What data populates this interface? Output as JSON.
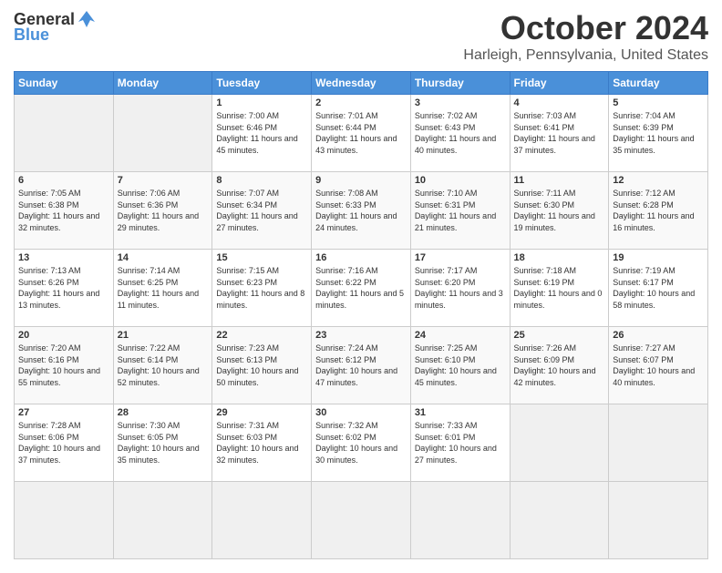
{
  "logo": {
    "general": "General",
    "blue": "Blue"
  },
  "title": "October 2024",
  "location": "Harleigh, Pennsylvania, United States",
  "weekdays": [
    "Sunday",
    "Monday",
    "Tuesday",
    "Wednesday",
    "Thursday",
    "Friday",
    "Saturday"
  ],
  "days": [
    {
      "num": "",
      "sunrise": "",
      "sunset": "",
      "daylight": ""
    },
    {
      "num": "",
      "sunrise": "",
      "sunset": "",
      "daylight": ""
    },
    {
      "num": "1",
      "sunrise": "Sunrise: 7:00 AM",
      "sunset": "Sunset: 6:46 PM",
      "daylight": "Daylight: 11 hours and 45 minutes."
    },
    {
      "num": "2",
      "sunrise": "Sunrise: 7:01 AM",
      "sunset": "Sunset: 6:44 PM",
      "daylight": "Daylight: 11 hours and 43 minutes."
    },
    {
      "num": "3",
      "sunrise": "Sunrise: 7:02 AM",
      "sunset": "Sunset: 6:43 PM",
      "daylight": "Daylight: 11 hours and 40 minutes."
    },
    {
      "num": "4",
      "sunrise": "Sunrise: 7:03 AM",
      "sunset": "Sunset: 6:41 PM",
      "daylight": "Daylight: 11 hours and 37 minutes."
    },
    {
      "num": "5",
      "sunrise": "Sunrise: 7:04 AM",
      "sunset": "Sunset: 6:39 PM",
      "daylight": "Daylight: 11 hours and 35 minutes."
    },
    {
      "num": "6",
      "sunrise": "Sunrise: 7:05 AM",
      "sunset": "Sunset: 6:38 PM",
      "daylight": "Daylight: 11 hours and 32 minutes."
    },
    {
      "num": "7",
      "sunrise": "Sunrise: 7:06 AM",
      "sunset": "Sunset: 6:36 PM",
      "daylight": "Daylight: 11 hours and 29 minutes."
    },
    {
      "num": "8",
      "sunrise": "Sunrise: 7:07 AM",
      "sunset": "Sunset: 6:34 PM",
      "daylight": "Daylight: 11 hours and 27 minutes."
    },
    {
      "num": "9",
      "sunrise": "Sunrise: 7:08 AM",
      "sunset": "Sunset: 6:33 PM",
      "daylight": "Daylight: 11 hours and 24 minutes."
    },
    {
      "num": "10",
      "sunrise": "Sunrise: 7:10 AM",
      "sunset": "Sunset: 6:31 PM",
      "daylight": "Daylight: 11 hours and 21 minutes."
    },
    {
      "num": "11",
      "sunrise": "Sunrise: 7:11 AM",
      "sunset": "Sunset: 6:30 PM",
      "daylight": "Daylight: 11 hours and 19 minutes."
    },
    {
      "num": "12",
      "sunrise": "Sunrise: 7:12 AM",
      "sunset": "Sunset: 6:28 PM",
      "daylight": "Daylight: 11 hours and 16 minutes."
    },
    {
      "num": "13",
      "sunrise": "Sunrise: 7:13 AM",
      "sunset": "Sunset: 6:26 PM",
      "daylight": "Daylight: 11 hours and 13 minutes."
    },
    {
      "num": "14",
      "sunrise": "Sunrise: 7:14 AM",
      "sunset": "Sunset: 6:25 PM",
      "daylight": "Daylight: 11 hours and 11 minutes."
    },
    {
      "num": "15",
      "sunrise": "Sunrise: 7:15 AM",
      "sunset": "Sunset: 6:23 PM",
      "daylight": "Daylight: 11 hours and 8 minutes."
    },
    {
      "num": "16",
      "sunrise": "Sunrise: 7:16 AM",
      "sunset": "Sunset: 6:22 PM",
      "daylight": "Daylight: 11 hours and 5 minutes."
    },
    {
      "num": "17",
      "sunrise": "Sunrise: 7:17 AM",
      "sunset": "Sunset: 6:20 PM",
      "daylight": "Daylight: 11 hours and 3 minutes."
    },
    {
      "num": "18",
      "sunrise": "Sunrise: 7:18 AM",
      "sunset": "Sunset: 6:19 PM",
      "daylight": "Daylight: 11 hours and 0 minutes."
    },
    {
      "num": "19",
      "sunrise": "Sunrise: 7:19 AM",
      "sunset": "Sunset: 6:17 PM",
      "daylight": "Daylight: 10 hours and 58 minutes."
    },
    {
      "num": "20",
      "sunrise": "Sunrise: 7:20 AM",
      "sunset": "Sunset: 6:16 PM",
      "daylight": "Daylight: 10 hours and 55 minutes."
    },
    {
      "num": "21",
      "sunrise": "Sunrise: 7:22 AM",
      "sunset": "Sunset: 6:14 PM",
      "daylight": "Daylight: 10 hours and 52 minutes."
    },
    {
      "num": "22",
      "sunrise": "Sunrise: 7:23 AM",
      "sunset": "Sunset: 6:13 PM",
      "daylight": "Daylight: 10 hours and 50 minutes."
    },
    {
      "num": "23",
      "sunrise": "Sunrise: 7:24 AM",
      "sunset": "Sunset: 6:12 PM",
      "daylight": "Daylight: 10 hours and 47 minutes."
    },
    {
      "num": "24",
      "sunrise": "Sunrise: 7:25 AM",
      "sunset": "Sunset: 6:10 PM",
      "daylight": "Daylight: 10 hours and 45 minutes."
    },
    {
      "num": "25",
      "sunrise": "Sunrise: 7:26 AM",
      "sunset": "Sunset: 6:09 PM",
      "daylight": "Daylight: 10 hours and 42 minutes."
    },
    {
      "num": "26",
      "sunrise": "Sunrise: 7:27 AM",
      "sunset": "Sunset: 6:07 PM",
      "daylight": "Daylight: 10 hours and 40 minutes."
    },
    {
      "num": "27",
      "sunrise": "Sunrise: 7:28 AM",
      "sunset": "Sunset: 6:06 PM",
      "daylight": "Daylight: 10 hours and 37 minutes."
    },
    {
      "num": "28",
      "sunrise": "Sunrise: 7:30 AM",
      "sunset": "Sunset: 6:05 PM",
      "daylight": "Daylight: 10 hours and 35 minutes."
    },
    {
      "num": "29",
      "sunrise": "Sunrise: 7:31 AM",
      "sunset": "Sunset: 6:03 PM",
      "daylight": "Daylight: 10 hours and 32 minutes."
    },
    {
      "num": "30",
      "sunrise": "Sunrise: 7:32 AM",
      "sunset": "Sunset: 6:02 PM",
      "daylight": "Daylight: 10 hours and 30 minutes."
    },
    {
      "num": "31",
      "sunrise": "Sunrise: 7:33 AM",
      "sunset": "Sunset: 6:01 PM",
      "daylight": "Daylight: 10 hours and 27 minutes."
    },
    {
      "num": "",
      "sunrise": "",
      "sunset": "",
      "daylight": ""
    },
    {
      "num": "",
      "sunrise": "",
      "sunset": "",
      "daylight": ""
    },
    {
      "num": "",
      "sunrise": "",
      "sunset": "",
      "daylight": ""
    }
  ]
}
